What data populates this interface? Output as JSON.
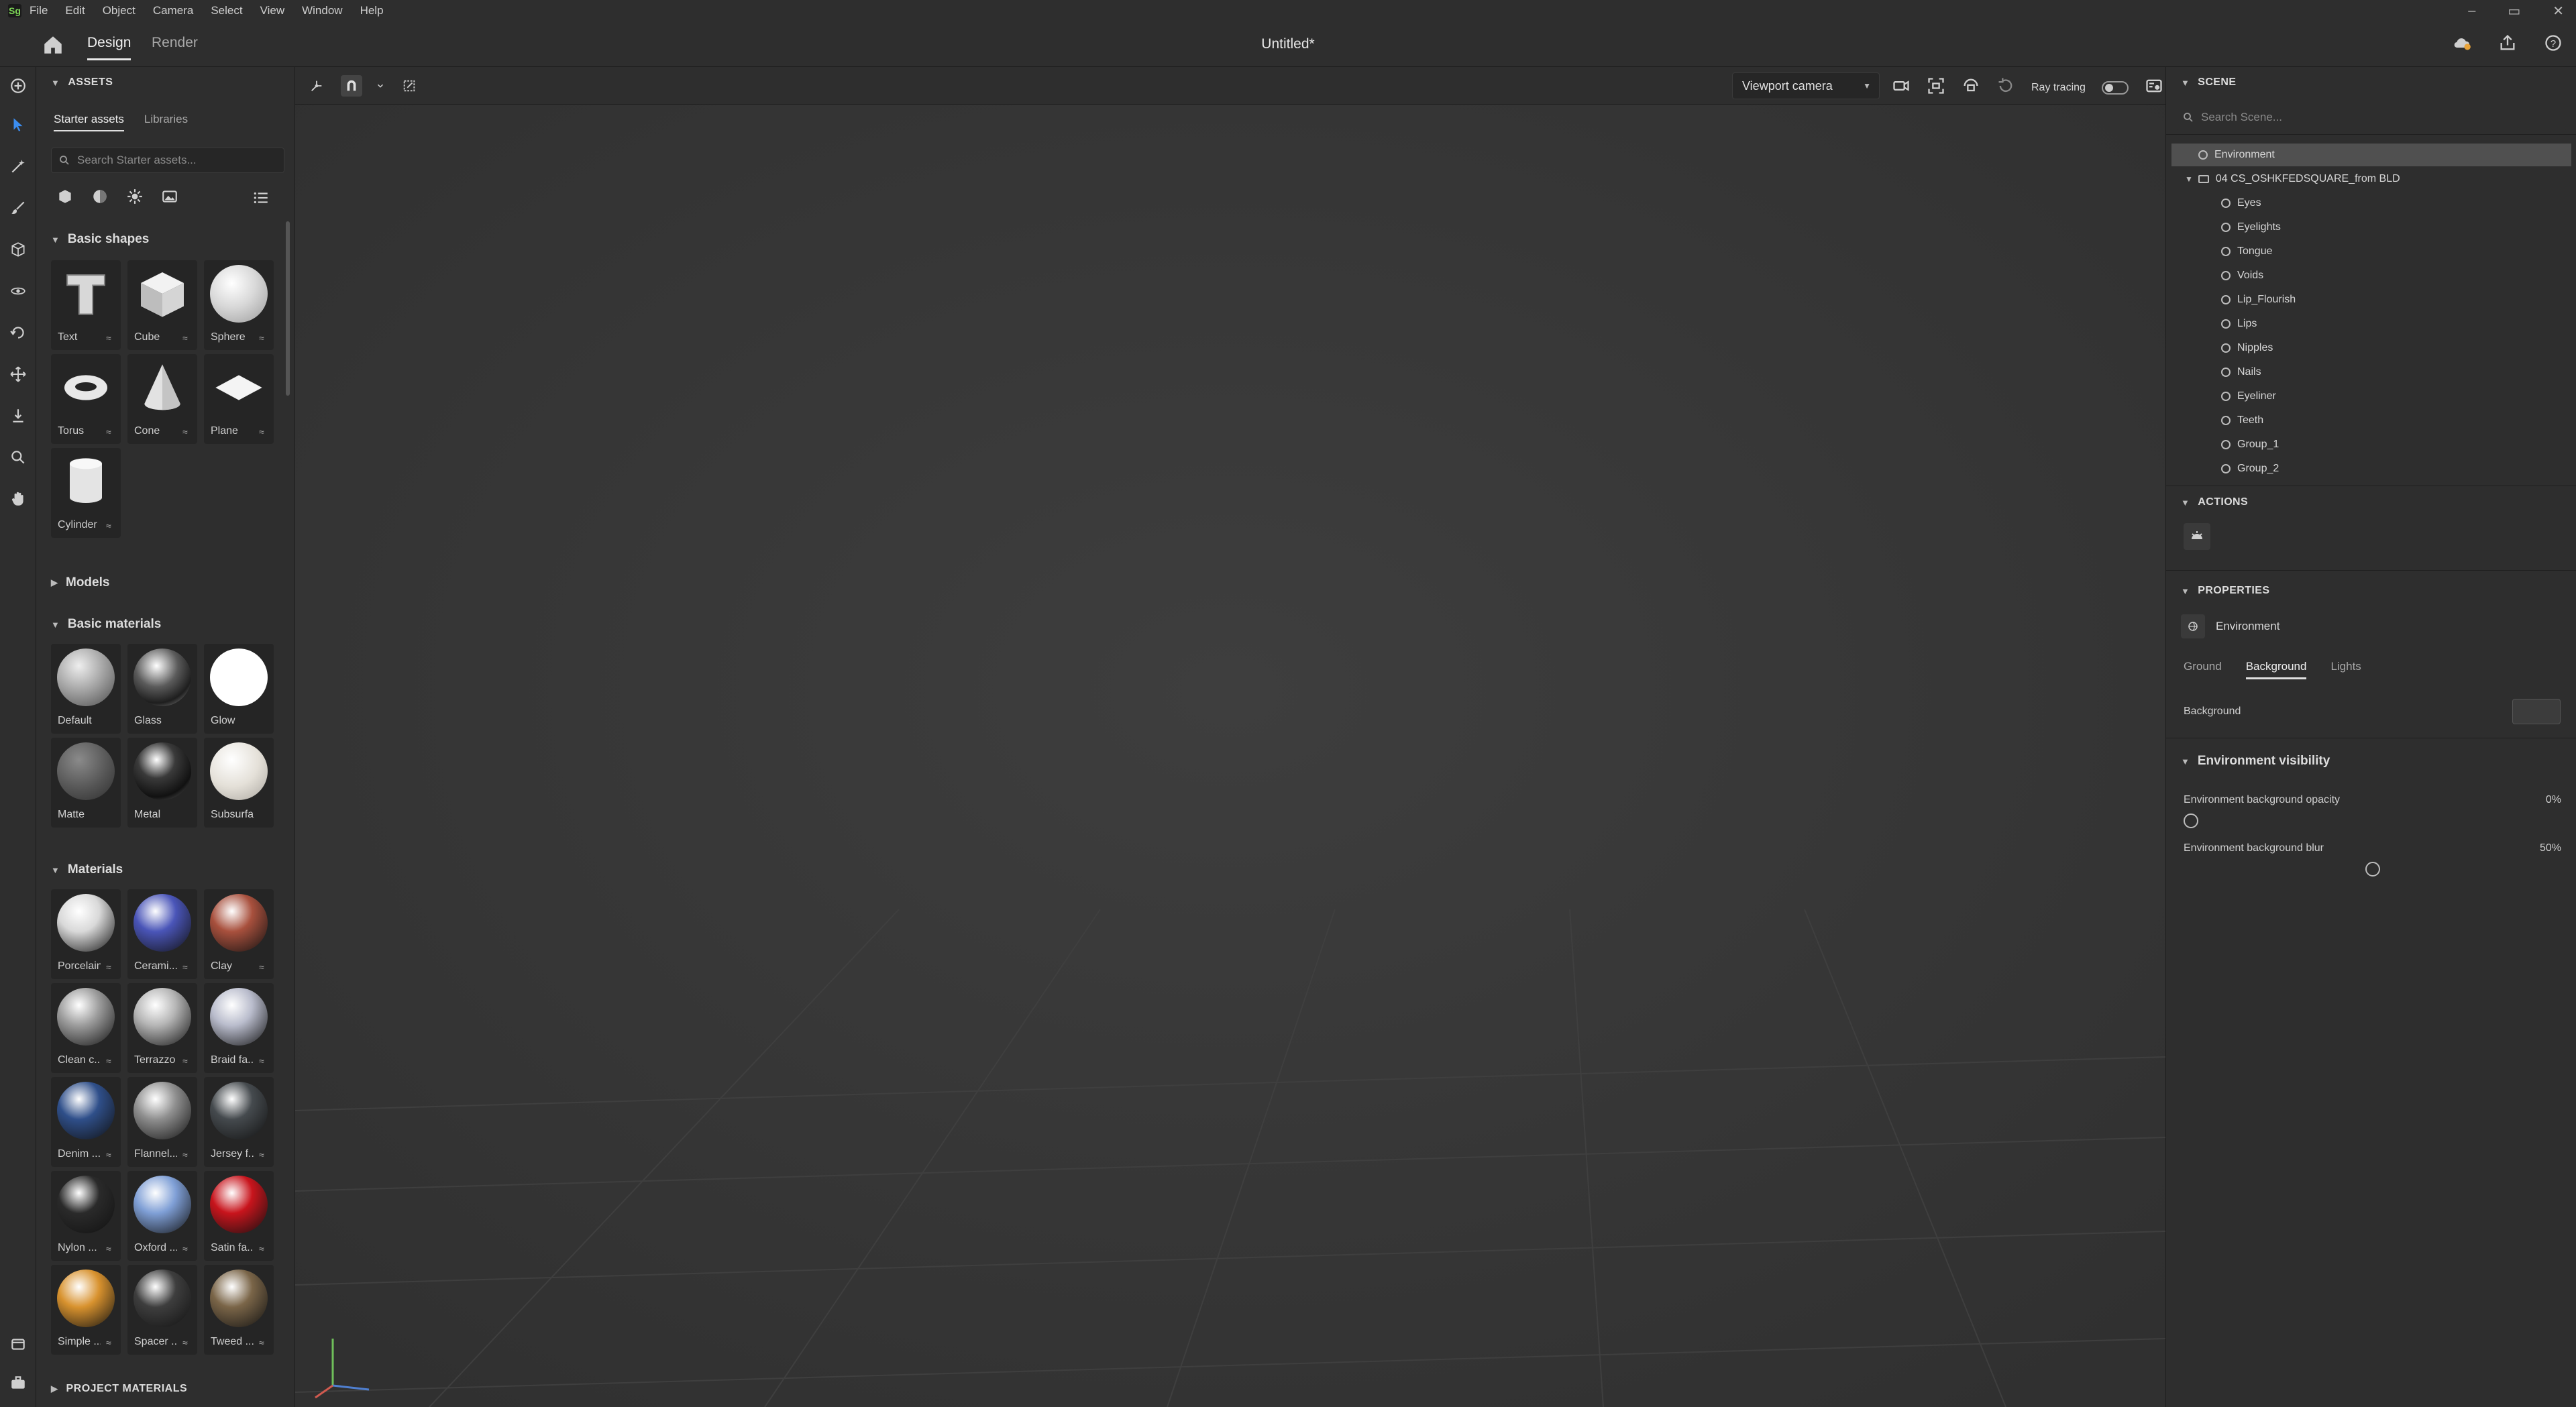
{
  "menu": {
    "logo_text": "Sg",
    "items": [
      "File",
      "Edit",
      "Object",
      "Camera",
      "Select",
      "View",
      "Window",
      "Help"
    ]
  },
  "window_controls": {
    "minimize": "–",
    "maximize": "▭",
    "close": "✕"
  },
  "header": {
    "tabs": [
      "Design",
      "Render"
    ],
    "active_tab": "Design",
    "document_title": "Untitled*"
  },
  "assets": {
    "title": "ASSETS",
    "subtabs": [
      "Starter assets",
      "Libraries"
    ],
    "search_placeholder": "Search Starter assets...",
    "basic_shapes": {
      "title": "Basic shapes",
      "items": [
        "Text",
        "Cube",
        "Sphere",
        "Torus",
        "Cone",
        "Plane",
        "Cylinder"
      ]
    },
    "models": {
      "title": "Models"
    },
    "basic_materials": {
      "title": "Basic materials",
      "items": [
        "Default",
        "Glass",
        "Glow",
        "Matte",
        "Metal",
        "Subsurface"
      ]
    },
    "materials": {
      "title": "Materials",
      "items": [
        "Porcelain",
        "Cerami...",
        "Clay",
        "Clean c...",
        "Terrazzo",
        "Braid fa...",
        "Denim ...",
        "Flannel...",
        "Jersey f...",
        "Nylon ...",
        "Oxford ...",
        "Satin fa...",
        "Simple ...",
        "Spacer ...",
        "Tweed ..."
      ],
      "colors": [
        "#d9d9d9",
        "#4a55b8",
        "#a8503d",
        "#9c9c9c",
        "#b5b5b5",
        "#b9bccc",
        "#2f4f8a",
        "#8f8f8f",
        "#454a4e",
        "#2a2a2a",
        "#7f9fd6",
        "#c8141c",
        "#d8922e",
        "#3e3e3e",
        "#7a6548"
      ]
    },
    "project_materials": {
      "title": "PROJECT MATERIALS"
    }
  },
  "viewport": {
    "camera_label": "Viewport camera",
    "ray_tracing_label": "Ray tracing",
    "ray_tracing_on": false
  },
  "scene": {
    "title": "SCENE",
    "search_placeholder": "Search Scene...",
    "items": [
      {
        "label": "Environment",
        "level": 0,
        "selected": true
      },
      {
        "label": "04 CS_OSHKFEDSQUARE_from BLD",
        "level": 0,
        "group": true
      },
      {
        "label": "Eyes",
        "level": 1
      },
      {
        "label": "Eyelights",
        "level": 1
      },
      {
        "label": "Tongue",
        "level": 1
      },
      {
        "label": "Voids",
        "level": 1
      },
      {
        "label": "Lip_Flourish",
        "level": 1
      },
      {
        "label": "Lips",
        "level": 1
      },
      {
        "label": "Nipples",
        "level": 1
      },
      {
        "label": "Nails",
        "level": 1
      },
      {
        "label": "Eyeliner",
        "level": 1
      },
      {
        "label": "Teeth",
        "level": 1
      },
      {
        "label": "Group_1",
        "level": 1
      },
      {
        "label": "Group_2",
        "level": 1
      }
    ]
  },
  "actions": {
    "title": "ACTIONS"
  },
  "properties": {
    "title": "PROPERTIES",
    "object_name": "Environment",
    "tabs": [
      "Ground",
      "Background",
      "Lights"
    ],
    "active_tab": "Background",
    "background_label": "Background",
    "env_visibility_title": "Environment visibility",
    "opacity_label": "Environment background opacity",
    "opacity_value": "0%",
    "opacity_fraction": 0,
    "blur_label": "Environment background blur",
    "blur_value": "50%",
    "blur_fraction": 0.5
  }
}
